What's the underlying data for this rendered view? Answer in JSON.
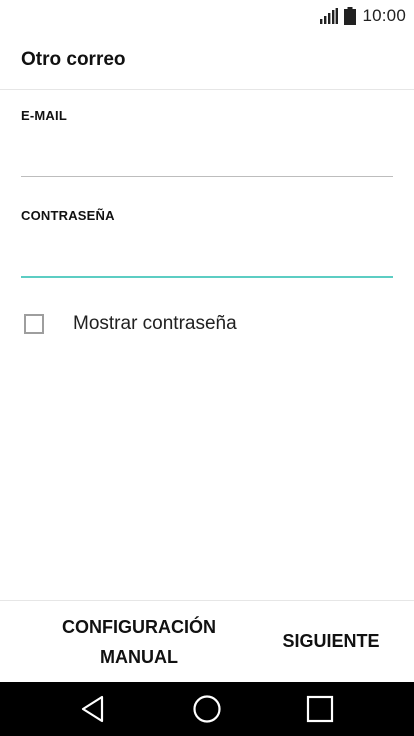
{
  "status_bar": {
    "time": "10:00",
    "icons": [
      "signal-icon",
      "battery-icon"
    ]
  },
  "header": {
    "title": "Otro correo"
  },
  "form": {
    "email": {
      "label": "E-MAIL",
      "value": "",
      "placeholder": ""
    },
    "password": {
      "label": "CONTRASEÑA",
      "value": "",
      "placeholder": ""
    },
    "show_password": {
      "label": "Mostrar contraseña",
      "checked": false
    }
  },
  "actions": {
    "manual_line1": "CONFIGURACIÓN",
    "manual_line2": "MANUAL",
    "next": "SIGUIENTE"
  },
  "nav_bar": {
    "icons": [
      "back-icon",
      "home-icon",
      "recents-icon"
    ]
  },
  "colors": {
    "accent": "#5ccdc3",
    "underline": "#bdbdbd",
    "nav_background": "#000000"
  }
}
